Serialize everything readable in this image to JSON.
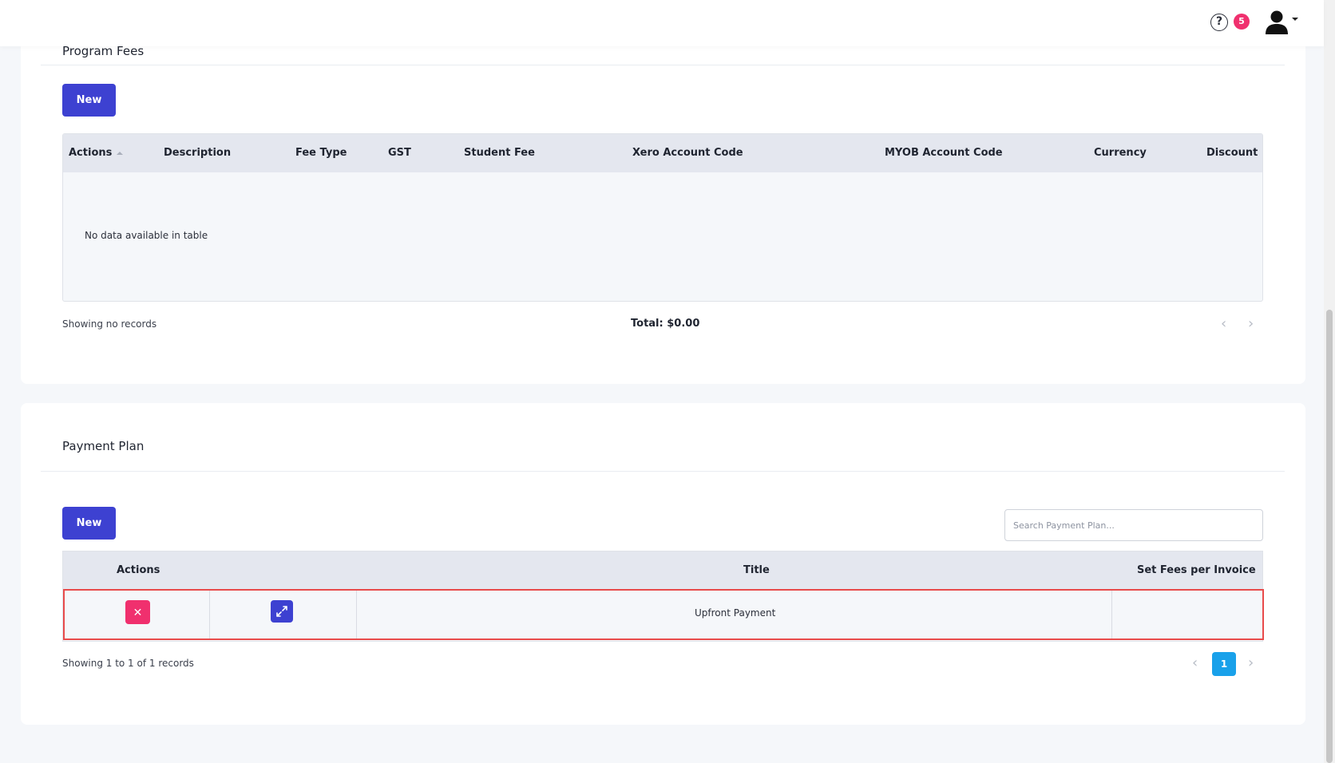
{
  "topbar": {
    "help_icon": "question-circle-icon",
    "notification_count": "5",
    "avatar_icon": "user-icon"
  },
  "program_fees": {
    "title": "Program Fees",
    "new_label": "New",
    "columns": [
      "Actions",
      "Description",
      "Fee Type",
      "GST",
      "Student Fee",
      "Xero Account Code",
      "MYOB Account Code",
      "Currency",
      "Discount"
    ],
    "empty_message": "No data available in table",
    "showing_text": "Showing no records",
    "total_text": "Total: $0.00",
    "prev_arrow": "‹",
    "next_arrow": "›"
  },
  "payment_plan": {
    "title": "Payment Plan",
    "new_label": "New",
    "search_placeholder": "Search Payment Plan...",
    "columns": [
      "Actions",
      "Title",
      "Set Fees per Invoice"
    ],
    "rows": [
      {
        "title": "Upfront Payment",
        "set_fees_per_invoice": ""
      }
    ],
    "showing_text": "Showing 1 to 1 of 1 records",
    "current_page": "1",
    "prev_arrow": "‹",
    "next_arrow": "›"
  },
  "colors": {
    "primary": "#3d41d1",
    "danger": "#f0306e",
    "pagination_active": "#19a1ea",
    "highlight_border": "#e84b4b"
  }
}
